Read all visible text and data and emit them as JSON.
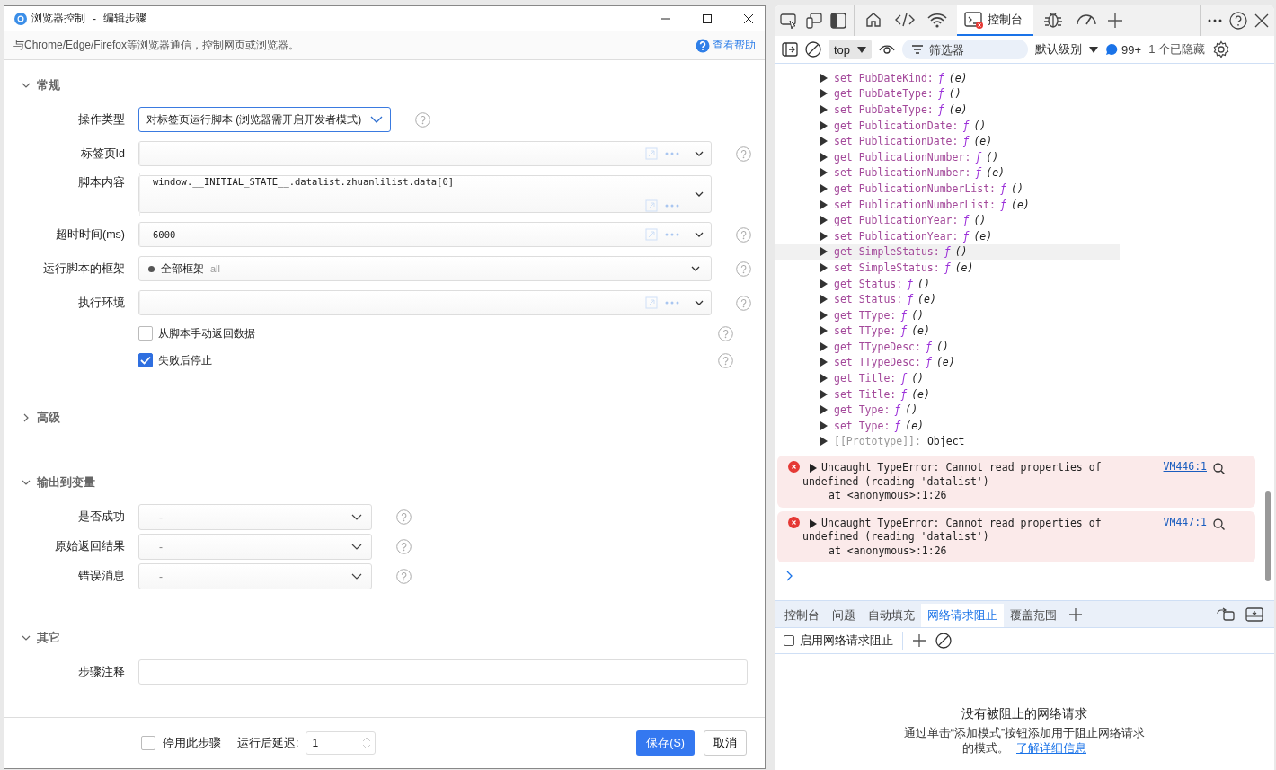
{
  "dialog": {
    "title": "浏览器控制",
    "title_sep": "-",
    "subtitle_title": "编辑步骤",
    "description": "与Chrome/Edge/Firefox等浏览器通信，控制网页或浏览器。",
    "help_link": "查看帮助",
    "sections": [
      {
        "title": "常规",
        "expanded": true,
        "fields": [
          {
            "kind": "select",
            "label": "操作类型",
            "value": "对标签页运行脚本 (浏览器需开启开发者模式)"
          },
          {
            "kind": "combo",
            "label": "标签页Id"
          },
          {
            "kind": "textarea",
            "label": "脚本内容",
            "value": "window.__INITIAL_STATE__.datalist.zhuanlilist.data[0]"
          },
          {
            "kind": "combo",
            "label": "超时时间(ms)",
            "value": "6000"
          },
          {
            "kind": "frame",
            "label": "运行脚本的框架",
            "value": "全部框架",
            "hint": "all"
          },
          {
            "kind": "combo",
            "label": "执行环境"
          },
          {
            "kind": "checkbox",
            "label": "从脚本手动返回数据",
            "checked": false
          },
          {
            "kind": "checkbox",
            "label": "失败后停止",
            "checked": true
          }
        ]
      },
      {
        "title": "高级",
        "expanded": false
      },
      {
        "title": "输出到变量",
        "expanded": true,
        "fields": [
          {
            "kind": "var",
            "label": "是否成功",
            "placeholder": "-"
          },
          {
            "kind": "var",
            "label": "原始返回结果",
            "placeholder": "-"
          },
          {
            "kind": "var",
            "label": "错误消息",
            "placeholder": "-"
          }
        ]
      },
      {
        "title": "其它",
        "expanded": true,
        "fields": [
          {
            "kind": "text",
            "label": "步骤注释"
          }
        ]
      }
    ],
    "footer": {
      "disable_label": "停用此步骤",
      "disable_checked": false,
      "delay_label": "运行后延迟:",
      "delay_value": "1",
      "save": "保存(S)",
      "cancel": "取消"
    }
  },
  "devtools": {
    "tabs": [
      {
        "kind": "home",
        "selected": false
      },
      {
        "kind": "code",
        "selected": false
      },
      {
        "kind": "wifi",
        "selected": false
      },
      {
        "kind": "console",
        "label": "控制台",
        "selected": true
      },
      {
        "kind": "bug",
        "selected": false
      },
      {
        "kind": "gauge",
        "selected": false
      }
    ],
    "context": "top",
    "filter_placeholder": "筛选器",
    "level": "默认级别",
    "message_count": "99+",
    "hidden": "1 个已隐藏",
    "lines": [
      {
        "kind": "prop",
        "label": "set PubDateKind:",
        "func": "ƒ",
        "args": "(e)",
        "selected": false
      },
      {
        "kind": "prop",
        "label": "get PubDateType:",
        "func": "ƒ",
        "args": "()",
        "selected": false
      },
      {
        "kind": "prop",
        "label": "set PubDateType:",
        "func": "ƒ",
        "args": "(e)",
        "selected": false
      },
      {
        "kind": "prop",
        "label": "get PublicationDate:",
        "func": "ƒ",
        "args": "()",
        "selected": false
      },
      {
        "kind": "prop",
        "label": "set PublicationDate:",
        "func": "ƒ",
        "args": "(e)",
        "selected": false
      },
      {
        "kind": "prop",
        "label": "get PublicationNumber:",
        "func": "ƒ",
        "args": "()",
        "selected": false
      },
      {
        "kind": "prop",
        "label": "set PublicationNumber:",
        "func": "ƒ",
        "args": "(e)",
        "selected": false
      },
      {
        "kind": "prop",
        "label": "get PublicationNumberList:",
        "func": "ƒ",
        "args": "()",
        "selected": false
      },
      {
        "kind": "prop",
        "label": "set PublicationNumberList:",
        "func": "ƒ",
        "args": "(e)",
        "selected": false
      },
      {
        "kind": "prop",
        "label": "get PublicationYear:",
        "func": "ƒ",
        "args": "()",
        "selected": false
      },
      {
        "kind": "prop",
        "label": "set PublicationYear:",
        "func": "ƒ",
        "args": "(e)",
        "selected": false
      },
      {
        "kind": "prop",
        "label": "get SimpleStatus:",
        "func": "ƒ",
        "args": "()",
        "selected": true
      },
      {
        "kind": "prop",
        "label": "set SimpleStatus:",
        "func": "ƒ",
        "args": "(e)",
        "selected": false
      },
      {
        "kind": "prop",
        "label": "get Status:",
        "func": "ƒ",
        "args": "()",
        "selected": false
      },
      {
        "kind": "prop",
        "label": "set Status:",
        "func": "ƒ",
        "args": "(e)",
        "selected": false
      },
      {
        "kind": "prop",
        "label": "get TType:",
        "func": "ƒ",
        "args": "()",
        "selected": false
      },
      {
        "kind": "prop",
        "label": "set TType:",
        "func": "ƒ",
        "args": "(e)",
        "selected": false
      },
      {
        "kind": "prop",
        "label": "get TTypeDesc:",
        "func": "ƒ",
        "args": "()",
        "selected": false
      },
      {
        "kind": "prop",
        "label": "set TTypeDesc:",
        "func": "ƒ",
        "args": "(e)",
        "selected": false
      },
      {
        "kind": "prop",
        "label": "get Title:",
        "func": "ƒ",
        "args": "()",
        "selected": false
      },
      {
        "kind": "prop",
        "label": "set Title:",
        "func": "ƒ",
        "args": "(e)",
        "selected": false
      },
      {
        "kind": "prop",
        "label": "get Type:",
        "func": "ƒ",
        "args": "()",
        "selected": false
      },
      {
        "kind": "prop",
        "label": "set Type:",
        "func": "ƒ",
        "args": "(e)",
        "selected": false
      },
      {
        "kind": "proto",
        "label": "[[Prototype]]:",
        "value": "Object",
        "selected": false
      }
    ],
    "errors": [
      {
        "message": "Uncaught TypeError: Cannot read properties of",
        "message2": "undefined (reading 'datalist')",
        "stack": "at <anonymous>:1:26",
        "source": "VM446:1"
      },
      {
        "message": "Uncaught TypeError: Cannot read properties of",
        "message2": "undefined (reading 'datalist')",
        "stack": "at <anonymous>:1:26",
        "source": "VM447:1"
      }
    ],
    "drawer_tabs": [
      {
        "label": "控制台",
        "selected": false
      },
      {
        "label": "问题",
        "selected": false
      },
      {
        "label": "自动填充",
        "selected": false
      },
      {
        "label": "网络请求阻止",
        "selected": true
      },
      {
        "label": "覆盖范围",
        "selected": false
      }
    ],
    "blocking": {
      "enable_label": "启用网络请求阻止",
      "enabled": false,
      "empty_title": "没有被阻止的网络请求",
      "empty_text": "通过单击“添加模式”按钮添加用于阻止网络请求",
      "empty_text2": "的模式。",
      "learn_more": "了解详细信息"
    }
  }
}
